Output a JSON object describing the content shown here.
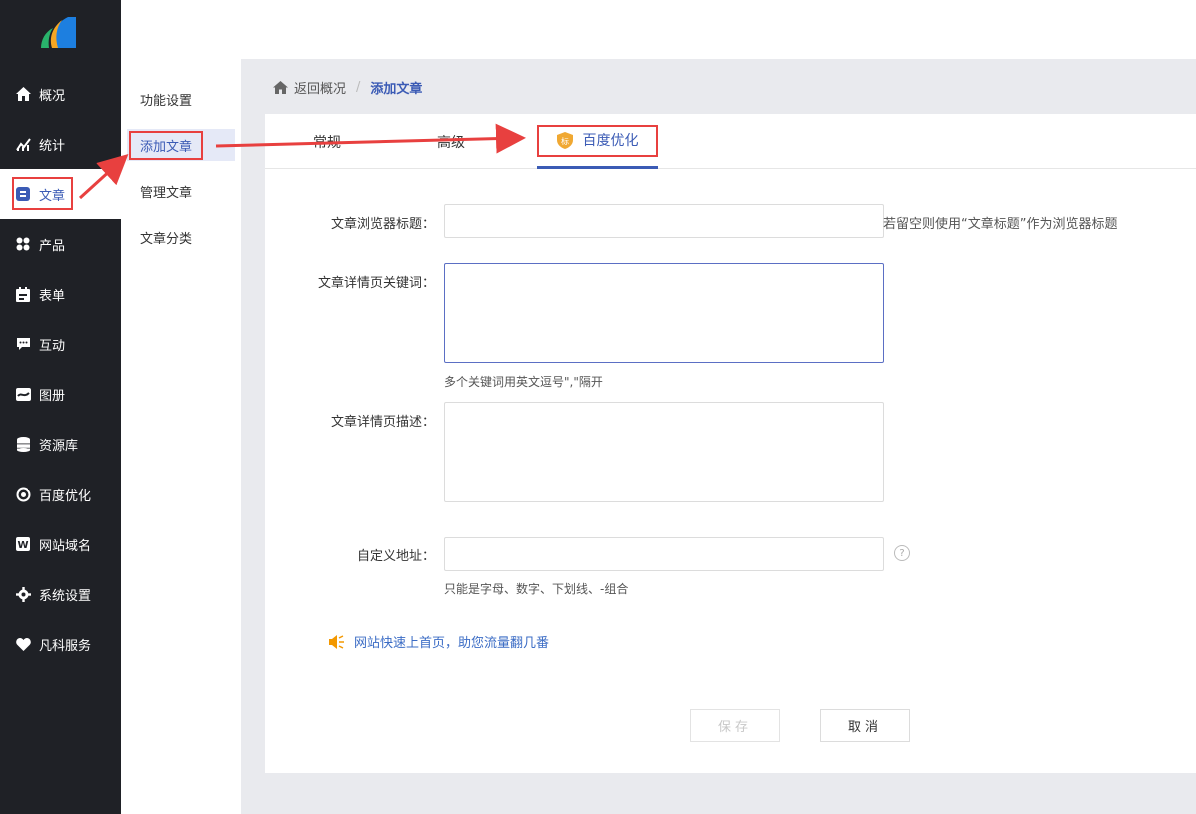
{
  "sidebar": {
    "items": [
      {
        "label": "概况",
        "icon": "home-icon"
      },
      {
        "label": "统计",
        "icon": "chart-icon"
      },
      {
        "label": "文章",
        "icon": "article-icon"
      },
      {
        "label": "产品",
        "icon": "grid-icon"
      },
      {
        "label": "表单",
        "icon": "calendar-icon"
      },
      {
        "label": "互动",
        "icon": "chat-icon"
      },
      {
        "label": "图册",
        "icon": "gallery-icon"
      },
      {
        "label": "资源库",
        "icon": "database-icon"
      },
      {
        "label": "百度优化",
        "icon": "seo-icon"
      },
      {
        "label": "网站域名",
        "icon": "w-icon"
      },
      {
        "label": "系统设置",
        "icon": "gear-icon"
      },
      {
        "label": "凡科服务",
        "icon": "heart-icon"
      }
    ],
    "active_index": 2
  },
  "submenu": {
    "items": [
      "功能设置",
      "添加文章",
      "管理文章",
      "文章分类"
    ],
    "active_index": 1
  },
  "breadcrumb": {
    "back": "返回概况",
    "separator": "/",
    "current": "添加文章"
  },
  "tabs": {
    "items": [
      "常规",
      "高级",
      "百度优化"
    ],
    "active_index": 2
  },
  "form": {
    "browser_title": {
      "label": "文章浏览器标题：",
      "value": "",
      "hint": "若留空则使用“文章标题”作为浏览器标题"
    },
    "keywords": {
      "label": "文章详情页关键词：",
      "value": "",
      "hint": "多个关键词用英文逗号\",\"隔开"
    },
    "description": {
      "label": "文章详情页描述：",
      "value": ""
    },
    "custom_url": {
      "label": "自定义地址：",
      "value": "",
      "hint": "只能是字母、数字、下划线、-组合",
      "help": "?"
    }
  },
  "promo": {
    "text": "网站快速上首页，助您流量翻几番"
  },
  "buttons": {
    "save": "保存",
    "cancel": "取消"
  },
  "colors": {
    "accent": "#3b5bb5",
    "sidebar_bg": "#1f2126",
    "highlight": "#e8403f",
    "promo_icon": "#f39800"
  }
}
